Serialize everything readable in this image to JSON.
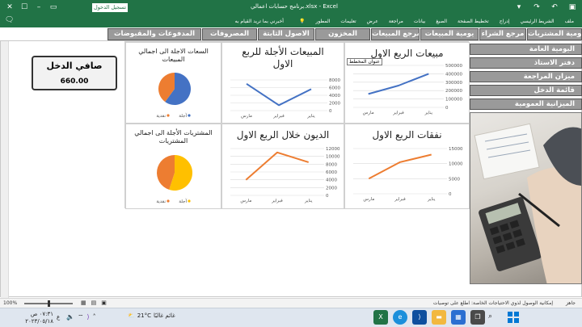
{
  "titlebar": {
    "title": "برنامج حسابات اعمالي.xlsx  -  Excel",
    "signin_label": "تسجيل الدخول",
    "tabs": [
      "ملف",
      "الشريط الرئيسي",
      "إدراج",
      "تخطيط الصفحة",
      "الصيغ",
      "بيانات",
      "مراجعة",
      "عرض",
      "تعليمات",
      "المطور"
    ],
    "search_label": "أخبرني بما تريد القيام به"
  },
  "nav_buttons": [
    "يومية المشتريات",
    "مرجع الشراء",
    "يومية المبيعات",
    "مرجع المبيعات",
    "المخزون",
    "الاصول الثابتة",
    "المصروفات",
    "المدفوعات والمقبوضات"
  ],
  "side_menu": [
    "اليومية العامة",
    "دفتر الاستاذ",
    "ميزان المراجعة",
    "قائمة الدخل",
    "الميزانية العمومية"
  ],
  "net_income": {
    "label": "صافي الدخل",
    "value": "660.00"
  },
  "colors": {
    "excel_green": "#217346",
    "blue_series": "#4472c4",
    "orange_series": "#ed7d31",
    "yellow_slice": "#ffc000",
    "nav_gray": "#9a9a9a"
  },
  "charts": {
    "sales_q1": {
      "title": "مبيعات الربع الاول",
      "tooltip": "عنوان المخطط",
      "chart_data": {
        "type": "line",
        "categories": [
          "يناير",
          "فبراير",
          "مارس"
        ],
        "values": [
          400000,
          260000,
          160000
        ],
        "ylim": [
          0,
          500000
        ],
        "yticks": [
          0,
          100000,
          200000,
          300000,
          400000,
          500000
        ],
        "color": "#4472c4"
      }
    },
    "credit_sales_q1": {
      "title_line1": "المبيعات الأجلة للربع",
      "title_line2": "الاول",
      "chart_data": {
        "type": "line",
        "categories": [
          "يناير",
          "فبراير",
          "مارس"
        ],
        "values": [
          5600,
          1400,
          7000
        ],
        "ylim": [
          0,
          8000
        ],
        "yticks": [
          0,
          2000,
          4000,
          6000,
          8000
        ],
        "color": "#4472c4"
      }
    },
    "credit_sales_pie": {
      "title_line1": "السعات الاجلة الى اجمالي",
      "title_line2": "المبيعات",
      "chart_data": {
        "type": "pie",
        "categories": [
          "آجلة",
          "نقدية"
        ],
        "values": [
          60,
          40
        ],
        "colors": [
          "#4472c4",
          "#ed7d31"
        ]
      }
    },
    "expenses_q1": {
      "title": "نفقات الربع الاول",
      "chart_data": {
        "type": "line",
        "categories": [
          "يناير",
          "فبراير",
          "مارس"
        ],
        "values": [
          13000,
          10500,
          5000
        ],
        "ylim": [
          0,
          15000
        ],
        "yticks": [
          0,
          5000,
          10000,
          15000
        ],
        "color": "#ed7d31"
      }
    },
    "debts_q1": {
      "title": "الديون خلال الربع الاول",
      "chart_data": {
        "type": "line",
        "categories": [
          "يناير",
          "فبراير",
          "مارس"
        ],
        "values": [
          8500,
          11000,
          4000
        ],
        "ylim": [
          0,
          12000
        ],
        "yticks": [
          0,
          2000,
          4000,
          6000,
          8000,
          10000,
          12000
        ],
        "color": "#ed7d31"
      }
    },
    "credit_purchases_pie": {
      "title_line1": "المشتريات الأجلة الى اجمالي",
      "title_line2": "المشتريات",
      "chart_data": {
        "type": "pie",
        "categories": [
          "آجلة",
          "نقدية"
        ],
        "values": [
          55,
          45
        ],
        "colors": [
          "#ffc000",
          "#ed7d31"
        ]
      }
    }
  },
  "statusbar": {
    "ready": "جاهز",
    "accessibility": "إمكانية الوصول لذوي الاحتياجات الخاصة: اطلع على توصيات",
    "zoom": "100%"
  },
  "taskbar": {
    "time": "٠٧:٣١ ص",
    "date": "٢٠٢٣/٠٥/١٨",
    "lang": "ع",
    "temp": "21°C",
    "weather": "غائم غالبًا"
  }
}
